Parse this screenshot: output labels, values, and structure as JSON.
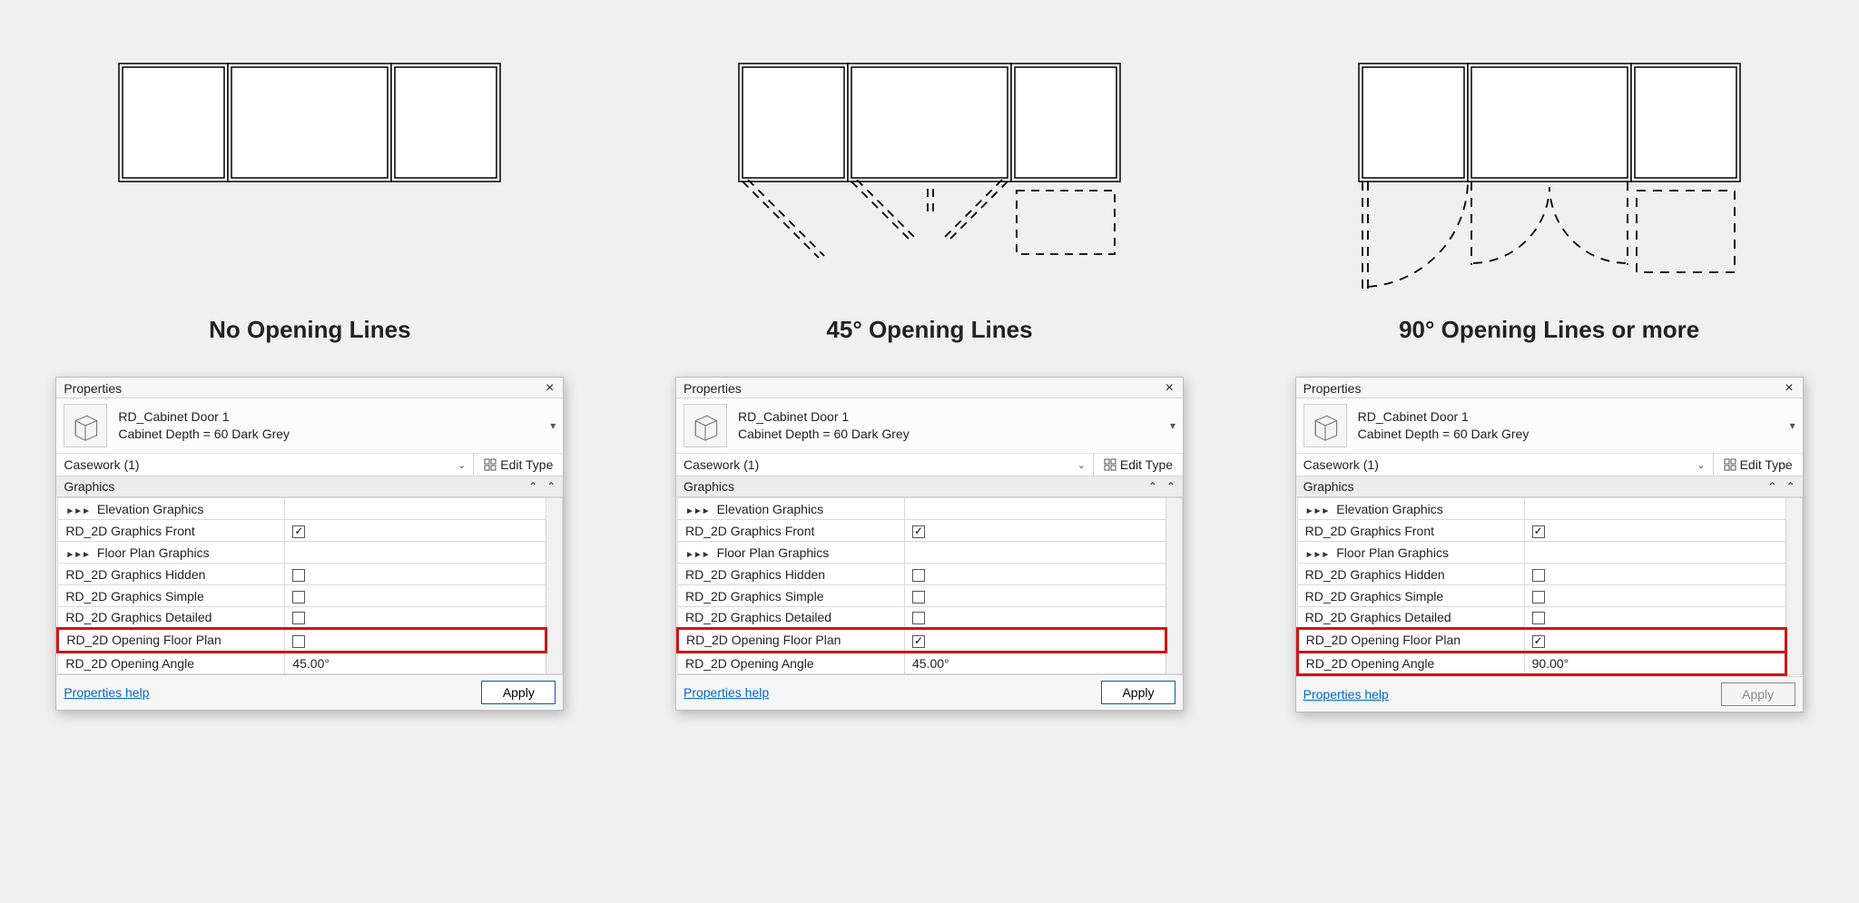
{
  "columns": [
    {
      "caption": "No Opening Lines",
      "opening_checked": false,
      "angle": "45.00°",
      "apply_active": true,
      "highlight": "single"
    },
    {
      "caption": "45° Opening Lines",
      "opening_checked": true,
      "angle": "45.00°",
      "apply_active": true,
      "highlight": "single"
    },
    {
      "caption": "90° Opening Lines or more",
      "opening_checked": true,
      "angle": "90.00°",
      "apply_active": false,
      "highlight": "double"
    }
  ],
  "panel": {
    "title": "Properties",
    "family": "RD_Cabinet Door 1",
    "type": "Cabinet Depth = 60 Dark Grey",
    "selector": "Casework (1)",
    "edit_type": "Edit Type",
    "group": "Graphics",
    "rows": {
      "elev": "Elevation Graphics",
      "front": "RD_2D Graphics Front",
      "floor": "Floor Plan Graphics",
      "hidden": "RD_2D Graphics Hidden",
      "simple": "RD_2D Graphics Simple",
      "detailed": "RD_2D Graphics Detailed",
      "opening": "RD_2D Opening Floor Plan",
      "angle": "RD_2D Opening Angle"
    },
    "help": "Properties help",
    "apply": "Apply"
  }
}
